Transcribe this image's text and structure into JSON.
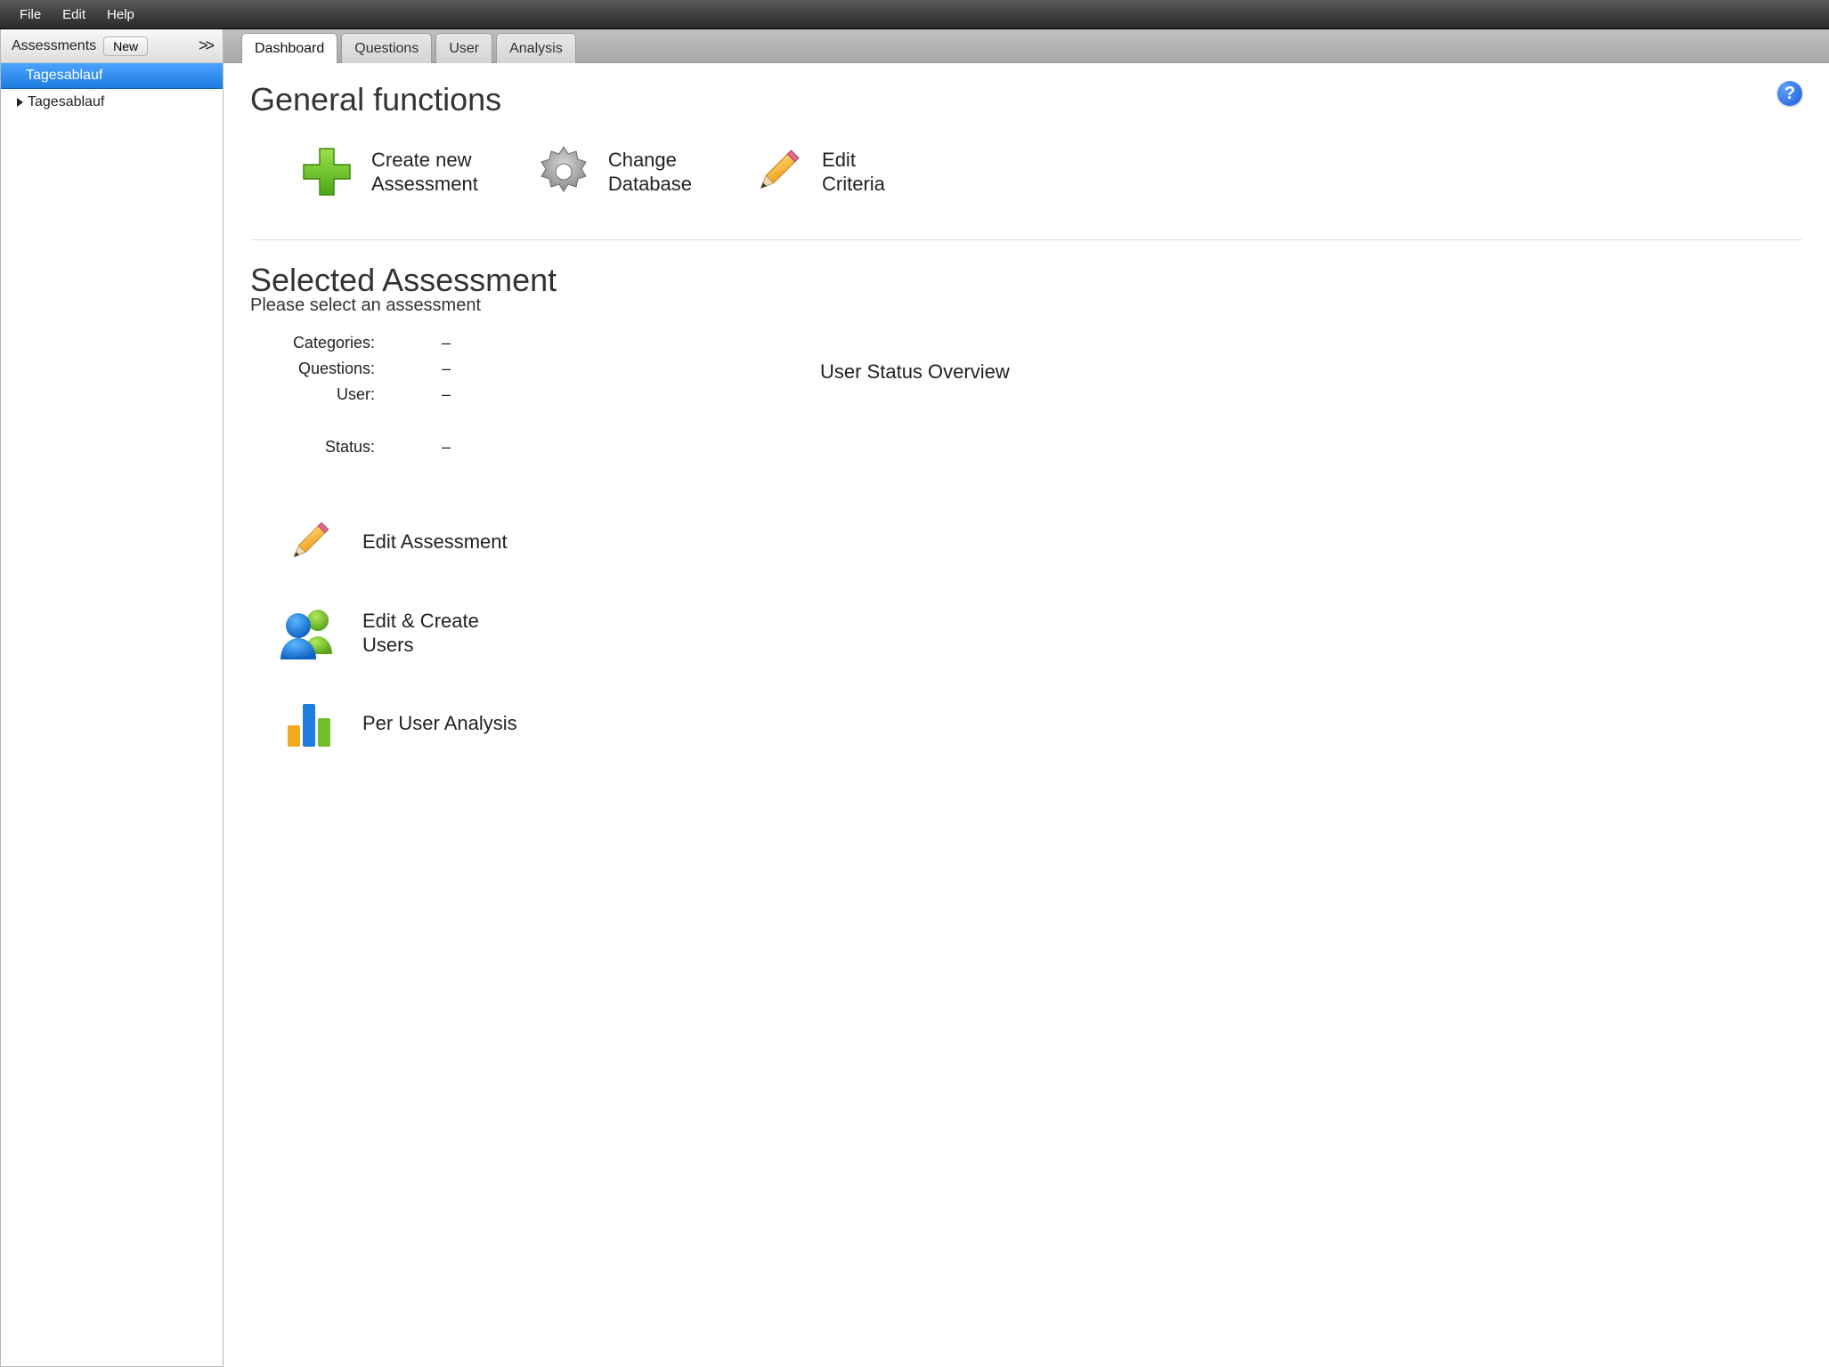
{
  "menubar": {
    "file": "File",
    "edit": "Edit",
    "help": "Help"
  },
  "sidebar": {
    "title": "Assessments",
    "new_btn": "New",
    "collapse": ">>",
    "tree_parent": "Tagesablauf",
    "tree_child": "Tagesablauf"
  },
  "tabs": {
    "dashboard": "Dashboard",
    "questions": "Questions",
    "user": "User",
    "analysis": "Analysis"
  },
  "help_badge": "?",
  "general": {
    "heading": "General functions",
    "create": "Create new\nAssessment",
    "change_db": "Change\nDatabase",
    "edit_criteria": "Edit\nCriteria"
  },
  "selected": {
    "heading": "Selected Assessment",
    "subtitle": "Please select an assessment",
    "categories_label": "Categories:",
    "categories_val": "–",
    "questions_label": "Questions:",
    "questions_val": "–",
    "user_label": "User:",
    "user_val": "–",
    "status_label": "Status:",
    "status_val": "–",
    "overview": "User Status Overview"
  },
  "actions": {
    "edit_assessment": "Edit Assessment",
    "edit_users": "Edit & Create\nUsers",
    "per_user": "Per User Analysis"
  }
}
